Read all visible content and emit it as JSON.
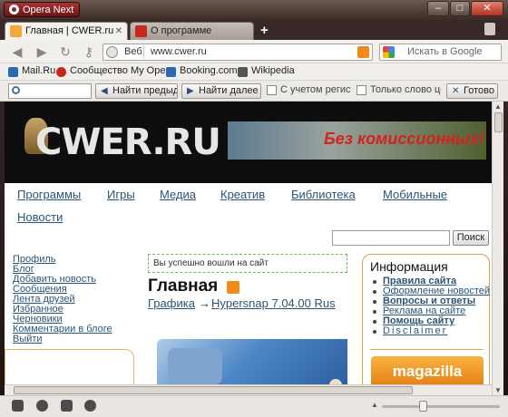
{
  "window": {
    "app_button": "Opera Next"
  },
  "tabs": [
    {
      "label": "Главная | CWER.ru",
      "active": true
    },
    {
      "label": "О программе",
      "active": false
    }
  ],
  "nav": {
    "address_label": "Веб",
    "url": "www.cwer.ru",
    "search_placeholder": "Искать в Google"
  },
  "bookmarks": [
    {
      "label": "Mail.Ru",
      "color": "#2a6ab5"
    },
    {
      "label": "Сообщество My Opera",
      "color": "#c8261d"
    },
    {
      "label": "Booking.com",
      "color": "#2a6ab5"
    },
    {
      "label": "Wikipedia",
      "color": "#555555"
    }
  ],
  "findbar": {
    "prev_label": "Найти предыдущее",
    "next_label": "Найти далее",
    "case_label": "С учетом регистра",
    "whole_label": "Только слово целиком",
    "done_label": "Готово"
  },
  "site": {
    "logo": "CWER.RU",
    "banner_text": "Без комиссионных!",
    "nav": [
      "Программы",
      "Игры",
      "Медиа",
      "Креатив",
      "Библиотека",
      "Мобильные",
      "Новости"
    ],
    "search_button": "Поиск",
    "user_links": [
      "Профиль",
      "Блог",
      "Добавить новость",
      "Сообщения",
      "Лента друзей",
      "Избранное",
      "Черновики",
      "Комментарии в блоге",
      "Выйти"
    ],
    "login_message": "Вы успешно вошли на сайт",
    "page_title": "Главная",
    "breadcrumb": {
      "category": "Графика",
      "arrow": "→",
      "item": "Hypersnap 7.04.00 Rus"
    },
    "info": {
      "title": "Информация",
      "items": [
        {
          "label": "Правила сайта",
          "bold": true
        },
        {
          "label": "Оформление новостей",
          "bold": false
        },
        {
          "label": "Вопросы и ответы",
          "bold": true
        },
        {
          "label": "Реклама на сайте",
          "bold": false
        },
        {
          "label": "Помощь сайту",
          "bold": true
        },
        {
          "label": "Disclaimer",
          "bold": false
        }
      ],
      "ad": "magazilla"
    }
  },
  "colors": {
    "link": "#2a5577",
    "info_border": "#e0a24a",
    "login_border": "#6cbe57",
    "banner_text": "#d3231c"
  }
}
